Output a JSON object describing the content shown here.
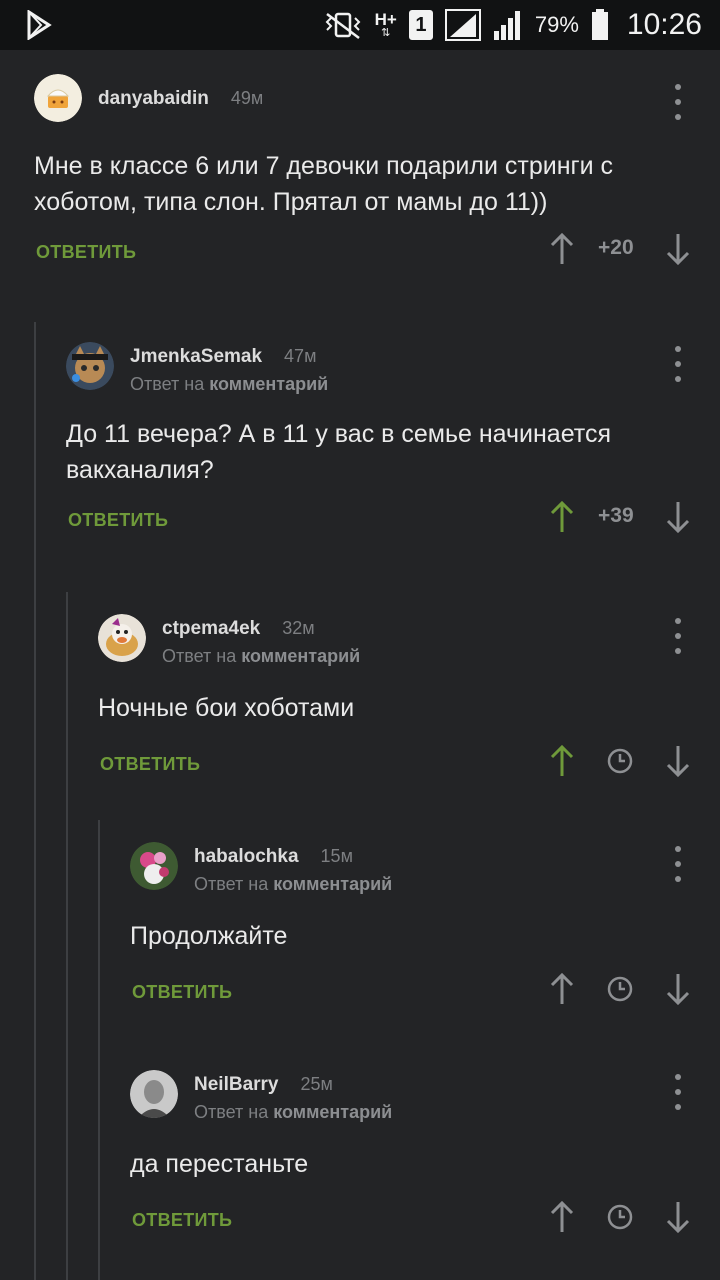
{
  "status_bar": {
    "battery": "79%",
    "time": "10:26",
    "sim_slot": "1",
    "network": "H+",
    "icons": [
      "play-store-icon",
      "vibrate-icon",
      "signal-icon",
      "battery-icon"
    ]
  },
  "labels": {
    "reply": "ОТВЕТИТЬ",
    "reply_to_prefix": "Ответ на",
    "reply_to_target": "комментарий"
  },
  "comments": [
    {
      "username": "danyabaidin",
      "time": "49м",
      "text": "Мне в классе 6 или 7 девочки подарили стринги с хоботом, типа слон. Прятал от мамы до 11))",
      "score": "+20",
      "upvoted": false
    },
    {
      "username": "JmenkaSemak",
      "time": "47м",
      "text": "До 11 вечера? А в 11 у вас в семье начинается вакханалия?",
      "score": "+39",
      "upvoted": true
    },
    {
      "username": "ctpema4ek",
      "time": "32м",
      "text": "Ночные бои хоботами",
      "score": "",
      "upvoted": true
    },
    {
      "username": "habalochka",
      "time": "15м",
      "text": "Продолжайте",
      "score": "",
      "upvoted": false
    },
    {
      "username": "NeilBarry",
      "time": "25м",
      "text": "да перестаньте",
      "score": "",
      "upvoted": false
    }
  ],
  "colors": {
    "background": "#232426",
    "accent_green": "#6f9a3a",
    "muted_text": "#7d7f82"
  }
}
